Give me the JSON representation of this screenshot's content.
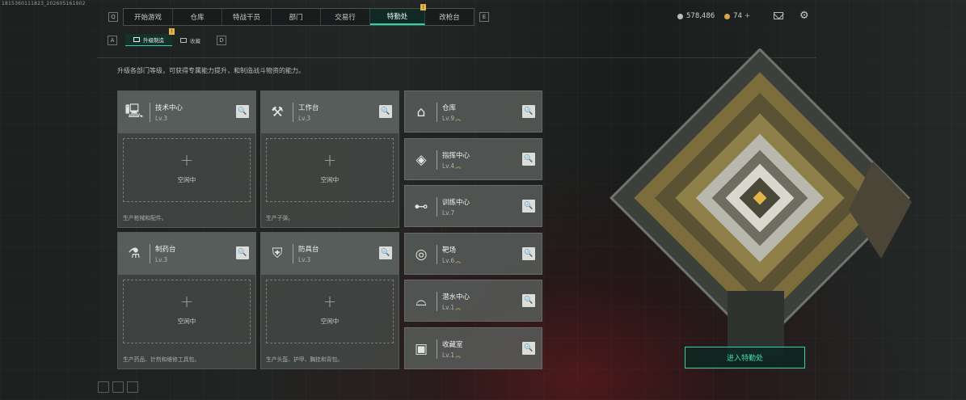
{
  "build_id": "1815360111823_202605161902",
  "topnav": {
    "left_key": "Q",
    "right_key": "E",
    "tabs": [
      {
        "label": "开始游戏"
      },
      {
        "label": "仓库"
      },
      {
        "label": "特战干员"
      },
      {
        "label": "部门"
      },
      {
        "label": "交易行"
      },
      {
        "label": "特勤处",
        "active": true,
        "badge": "!"
      },
      {
        "label": "改枪台"
      }
    ]
  },
  "resources": {
    "currency_a": "578,486",
    "currency_b": "74",
    "plus": "+"
  },
  "subnav": {
    "left_key": "A",
    "right_key": "D",
    "tabs": [
      {
        "label": "升级制造",
        "active": true,
        "badge": "!"
      },
      {
        "label": "收藏"
      }
    ]
  },
  "description": "升级各部门等级，可获得专属能力提升，和制造战斗物资的能力。",
  "workstations": [
    {
      "title": "技术中心",
      "level": "Lv.3",
      "slot_status": "空闲中",
      "slot_plus": "+",
      "footer": "生产枪械和配件。",
      "icon": "computer-icon"
    },
    {
      "title": "工作台",
      "level": "Lv.3",
      "slot_status": "空闲中",
      "slot_plus": "+",
      "footer": "生产子弹。",
      "icon": "tools-icon"
    },
    {
      "title": "制药台",
      "level": "Lv.3",
      "slot_status": "空闲中",
      "slot_plus": "+",
      "footer": "生产药品、针剂和维修工具包。",
      "icon": "microscope-icon"
    },
    {
      "title": "防具台",
      "level": "Lv.3",
      "slot_status": "空闲中",
      "slot_plus": "+",
      "footer": "生产头盔、护甲、胸挂和背包。",
      "icon": "armor-icon"
    }
  ],
  "side_facilities": [
    {
      "title": "仓库",
      "level": "Lv.9",
      "upgradable": true,
      "icon": "warehouse-icon"
    },
    {
      "title": "指挥中心",
      "level": "Lv.4",
      "upgradable": true,
      "icon": "command-icon"
    },
    {
      "title": "训练中心",
      "level": "Lv.7",
      "upgradable": false,
      "icon": "dumbbell-icon"
    },
    {
      "title": "靶场",
      "level": "Lv.6",
      "upgradable": true,
      "icon": "target-icon"
    },
    {
      "title": "潜水中心",
      "level": "Lv.1",
      "upgradable": true,
      "icon": "diving-mask-icon"
    },
    {
      "title": "收藏室",
      "level": "Lv.1",
      "upgradable": true,
      "icon": "collection-icon"
    }
  ],
  "upgrade_glyph": "︽",
  "zoom_glyph": "🔍",
  "enter_button": "进入特勤处",
  "colors": {
    "accent": "#2fd3a6",
    "badge": "#e2b545",
    "upgrade_arrow": "#d9b34a"
  }
}
